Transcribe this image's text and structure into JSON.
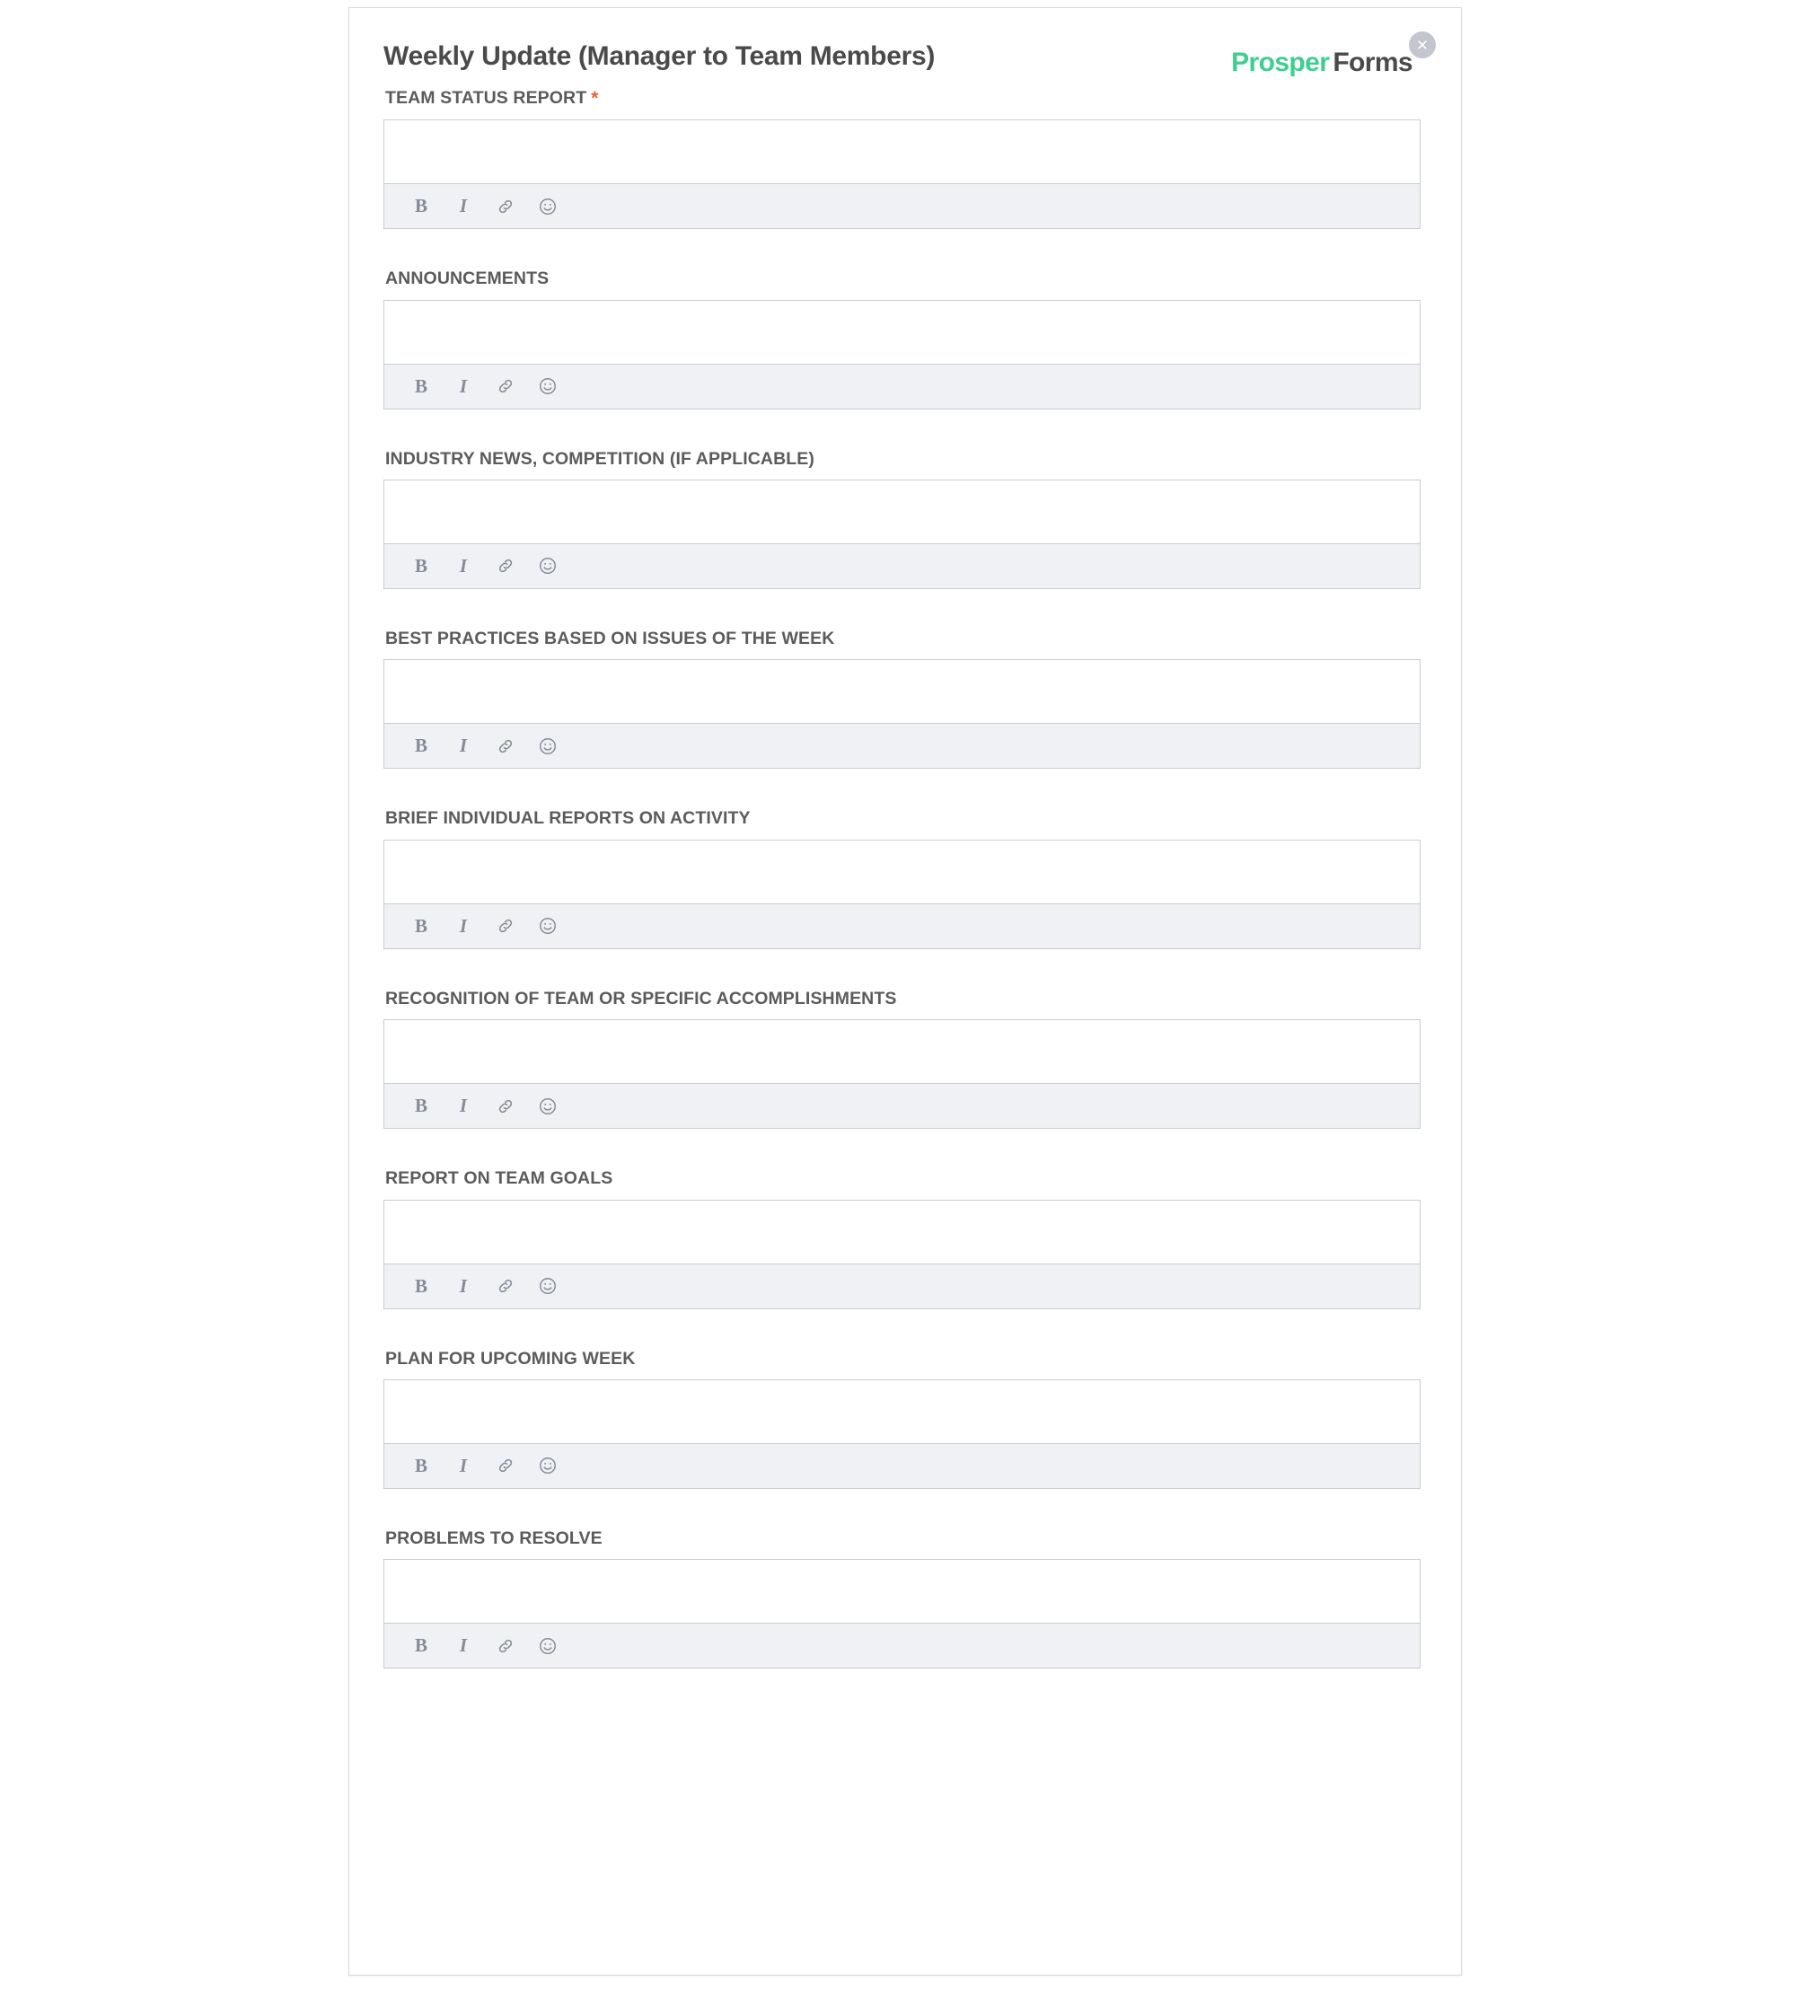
{
  "header": {
    "title": "Weekly Update (Manager to Team Members)",
    "brand_prosper": "Prosper",
    "brand_forms": "Forms",
    "close_label": "×"
  },
  "colors": {
    "brand_green": "#3ecf8e",
    "brand_dark": "#4a4a4a",
    "required_orange": "#e8633a",
    "toolbar_bg": "#f0f1f4",
    "field_border": "#c9ccd2",
    "card_border": "#d9dade"
  },
  "toolbar": {
    "buttons": [
      {
        "name": "bold",
        "glyph": "B",
        "title": "Bold"
      },
      {
        "name": "italic",
        "glyph": "I",
        "title": "Italic"
      },
      {
        "name": "link",
        "glyph": "🔗",
        "title": "Link"
      },
      {
        "name": "emoji",
        "glyph": "☺",
        "title": "Emoji"
      }
    ]
  },
  "fields": [
    {
      "label": "TEAM STATUS REPORT",
      "required": true,
      "value": "",
      "placeholder": ""
    },
    {
      "label": "ANNOUNCEMENTS",
      "required": false,
      "value": "",
      "placeholder": ""
    },
    {
      "label": "INDUSTRY NEWS, COMPETITION (IF APPLICABLE)",
      "required": false,
      "value": "",
      "placeholder": ""
    },
    {
      "label": "BEST PRACTICES BASED ON ISSUES OF THE WEEK",
      "required": false,
      "value": "",
      "placeholder": ""
    },
    {
      "label": "BRIEF INDIVIDUAL REPORTS ON ACTIVITY",
      "required": false,
      "value": "",
      "placeholder": ""
    },
    {
      "label": "RECOGNITION OF TEAM OR SPECIFIC ACCOMPLISHMENTS",
      "required": false,
      "value": "",
      "placeholder": ""
    },
    {
      "label": "REPORT ON TEAM GOALS",
      "required": false,
      "value": "",
      "placeholder": ""
    },
    {
      "label": "PLAN FOR UPCOMING WEEK",
      "required": false,
      "value": "",
      "placeholder": ""
    },
    {
      "label": "PROBLEMS TO RESOLVE",
      "required": false,
      "value": "",
      "placeholder": ""
    }
  ]
}
